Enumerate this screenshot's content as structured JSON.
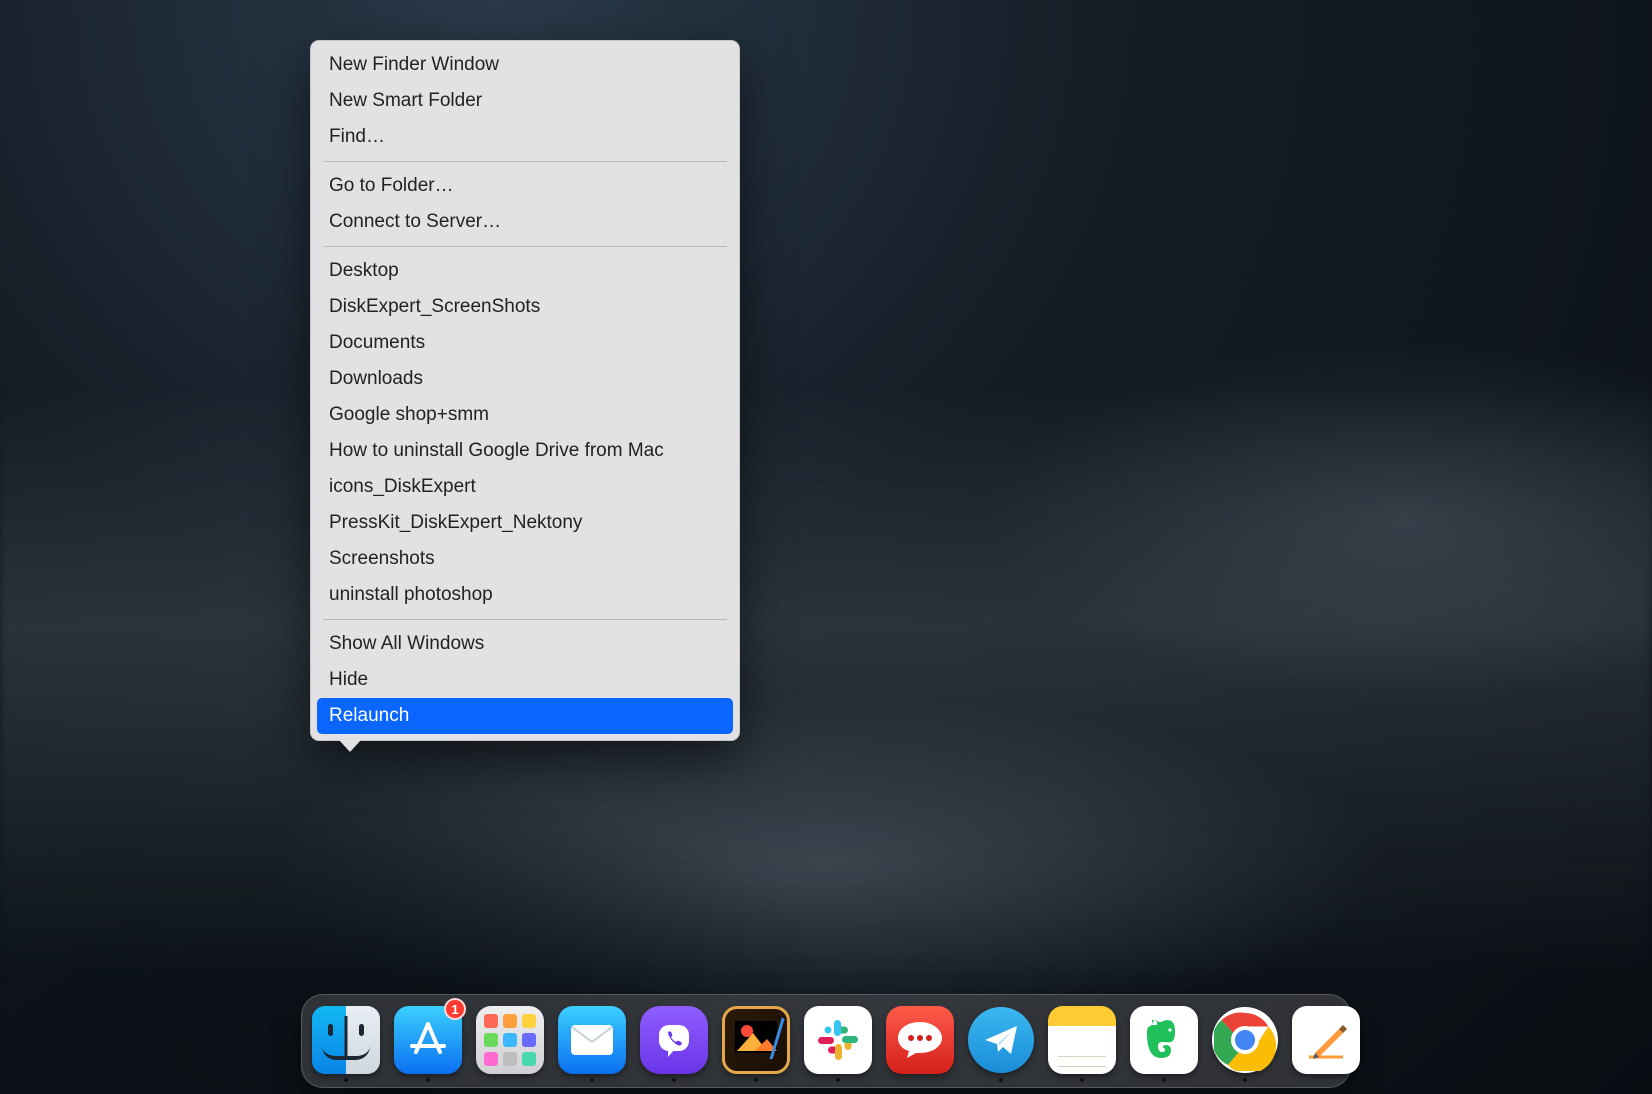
{
  "menu": {
    "groups": [
      [
        "New Finder Window",
        "New Smart Folder",
        "Find…"
      ],
      [
        "Go to Folder…",
        "Connect to Server…"
      ],
      [
        "Desktop",
        "DiskExpert_ScreenShots",
        "Documents",
        "Downloads",
        "Google shop+smm",
        "How to uninstall Google Drive from Mac",
        "icons_DiskExpert",
        "PressKit_DiskExpert_Nektony",
        "Screenshots",
        "uninstall photoshop"
      ],
      [
        "Show All Windows",
        "Hide",
        "Relaunch"
      ]
    ],
    "highlighted": "Relaunch"
  },
  "dock": {
    "items": [
      {
        "name": "Finder",
        "running": true
      },
      {
        "name": "App Store",
        "running": true,
        "badge": "1"
      },
      {
        "name": "Launchpad",
        "running": false
      },
      {
        "name": "Mail",
        "running": true
      },
      {
        "name": "Viber",
        "running": true
      },
      {
        "name": "Pixelmator",
        "running": true
      },
      {
        "name": "Slack",
        "running": true
      },
      {
        "name": "Messages",
        "running": false
      },
      {
        "name": "Telegram",
        "running": true
      },
      {
        "name": "Notes",
        "running": true
      },
      {
        "name": "Evernote",
        "running": true
      },
      {
        "name": "Google Chrome",
        "running": true
      },
      {
        "name": "Pages",
        "running": false
      }
    ]
  },
  "launchpad_colors": [
    "#ff6a57",
    "#ff9e3d",
    "#ffd23d",
    "#6ad85a",
    "#3db8ff",
    "#6a6aff",
    "#ff6ad0",
    "#bdbdbd",
    "#4ad8b0"
  ]
}
